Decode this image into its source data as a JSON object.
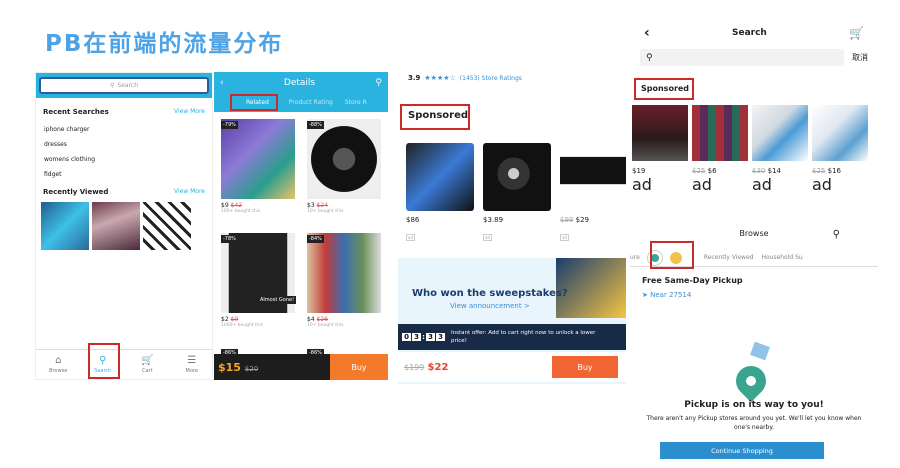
{
  "page_title": "PB在前端的流量分布",
  "panel1": {
    "search_placeholder": "Search",
    "recent_title": "Recent Searches",
    "view_more": "View More",
    "recent_items": [
      "iphone charger",
      "dresses",
      "womens clothing",
      "fidget"
    ],
    "recent_viewed_title": "Recently Viewed",
    "view_more_2": "View More",
    "tabs": [
      "Browse",
      "Search",
      "Cart",
      "More"
    ]
  },
  "panel2": {
    "title": "Details",
    "tabs": [
      "Related",
      "Product Rating",
      "Store R"
    ],
    "products": [
      {
        "badge": "-79%",
        "price": "$9",
        "old": "$42",
        "sold": "100+ bought this"
      },
      {
        "badge": "-88%",
        "price": "$3",
        "old": "$24",
        "sold": "10+ bought this"
      },
      {
        "badge": "-78%",
        "price": "$2",
        "old": "$9",
        "sold": "1000+ bought this"
      },
      {
        "badge": "-84%",
        "price": "$4",
        "old": "$26",
        "sold": "10+ bought this"
      }
    ],
    "almost_gone": "Almost Gone!",
    "row3_badges": [
      "-86%",
      "-86%"
    ],
    "buy_price": "$15",
    "buy_old": "$20",
    "buy_label": "Buy"
  },
  "panel3": {
    "rating_value": "3.9",
    "rating_count": "(1453) Store Ratings",
    "stars": 4,
    "sponsored": "Sponsored",
    "products": [
      {
        "price": "$86",
        "old": ""
      },
      {
        "price": "$3.89",
        "old": ""
      },
      {
        "price": "$29",
        "old": "$99"
      }
    ],
    "ad_label": "ad",
    "sweep_title": "Who won the sweepstakes?",
    "sweep_link": "View announcement >",
    "timer": [
      "0",
      "3",
      "3",
      "3"
    ],
    "offer_text": "Instant offer: Add to cart right now to unlock a lower price!",
    "old_price": "$199",
    "new_price": "$22",
    "buy_label": "Buy"
  },
  "panel4": {
    "title": "Search",
    "cancel": "取消",
    "sponsored": "Sponsored",
    "products": [
      {
        "price": "$19",
        "old": ""
      },
      {
        "price": "$6",
        "old": "$25"
      },
      {
        "price": "$14",
        "old": "$30"
      },
      {
        "price": "$16",
        "old": "$25"
      }
    ],
    "ad_label": "ad",
    "browse": "Browse",
    "tabs": [
      "ure",
      "Recently Viewed",
      "Household Su"
    ],
    "fsd_title": "Free Same-Day Pickup",
    "near": "Near 27514",
    "pickup_title": "Pickup is on its way to you!",
    "pickup_desc": "There aren't any Pickup stores around you yet. We'll let you know when one's nearby.",
    "continue": "Continue Shopping"
  },
  "colors": {
    "accent": "#2bb3e0",
    "highlight": "#c92a2a",
    "buy": "#f37a2b",
    "title": "#4da3e6"
  }
}
